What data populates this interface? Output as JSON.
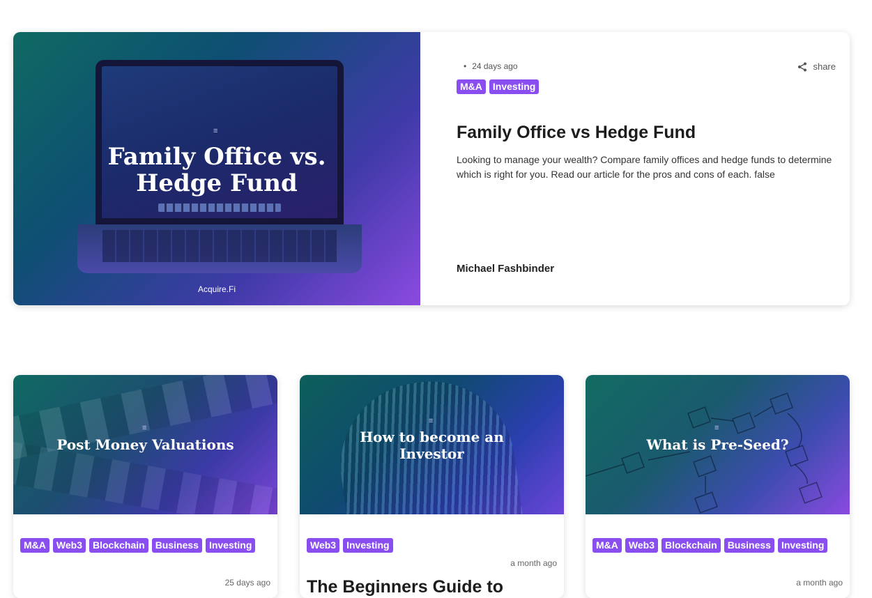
{
  "featured": {
    "image_title": "Family Office vs.\nHedge Fund",
    "image_brand": "Acquire.Fi",
    "date": "24 days ago",
    "share_label": "share",
    "tags": [
      "M&A",
      "Investing"
    ],
    "title": "Family Office vs Hedge Fund",
    "description": "Looking to manage your wealth? Compare family offices and hedge funds to determine which is right for you. Read our article for the pros and cons of each. false",
    "author": "Michael Fashbinder"
  },
  "cards": [
    {
      "image_title": "Post Money Valuations",
      "tags": [
        "M&A",
        "Web3",
        "Blockchain",
        "Business",
        "Investing"
      ],
      "date": "25 days ago"
    },
    {
      "image_title": "How to become an\nInvestor",
      "tags": [
        "Web3",
        "Investing"
      ],
      "date": "a month ago",
      "title": "The Beginners Guide to"
    },
    {
      "image_title": "What is Pre-Seed?",
      "tags": [
        "M&A",
        "Web3",
        "Blockchain",
        "Business",
        "Investing"
      ],
      "date": "a month ago"
    }
  ],
  "colors": {
    "tag_bg": "#8a4ef0",
    "accent_gradient_end": "#8b4ae0"
  }
}
